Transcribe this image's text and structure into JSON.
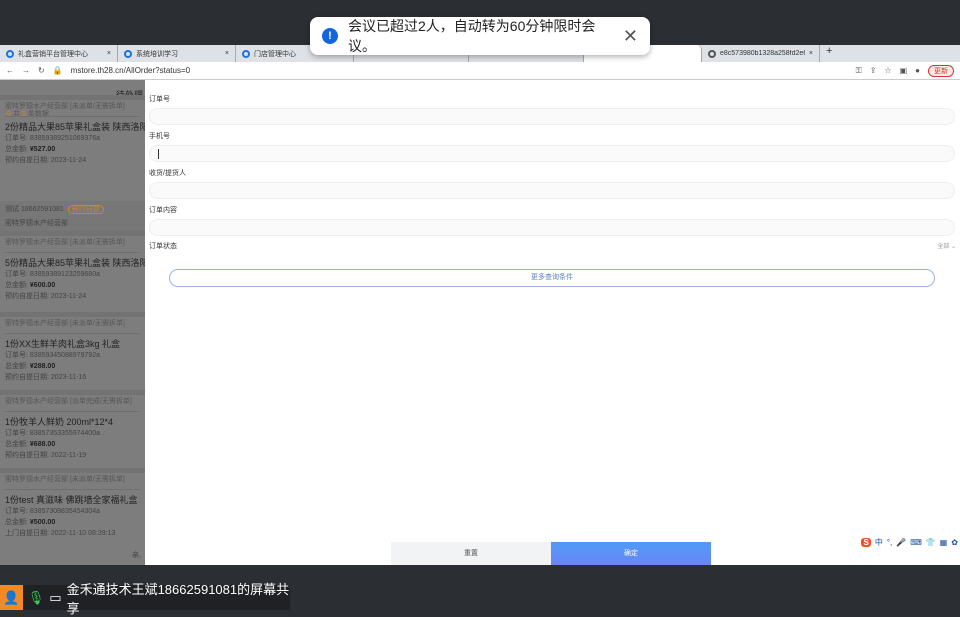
{
  "notification": {
    "message": "会议已超过2人，自动转为60分钟限时会议。",
    "close": "✕"
  },
  "browser": {
    "tabs": [
      {
        "title": "礼盒营销平台管理中心"
      },
      {
        "title": "系统培训学习"
      },
      {
        "title": "门店管理中心"
      },
      {
        "title": "e8c573980b1328a258fd2e6f..."
      }
    ],
    "new_tab": "+",
    "url": "mstore.th28.cn/AllOrder?status=0",
    "update_label": "更新"
  },
  "sidebar": {
    "header": "待处理",
    "count_prefix": "共",
    "count": "5",
    "count_suffix": "条数据",
    "orders": [
      {
        "shop": "密特罗德水产经营部 [未派单/无需拆单]",
        "title": "2份精品大果85苹果礼盒装 陕西洛阳16",
        "order_label": "订单号:",
        "order_no": "83859389251069376a",
        "amount_label": "总金额:",
        "amount": "¥527.00",
        "date_label": "预约自提日期:",
        "date": "2023-11-24",
        "contact": "测试",
        "phone": "18662591081",
        "badge": "预约自提",
        "store": "密特罗德水产经营部"
      },
      {
        "shop": "密特罗德水产经营部 [未派单/无需拆单]",
        "title": "5份精品大果85苹果礼盒装 陕西洛阳16",
        "order_label": "订单号:",
        "order_no": "83859389123259680a",
        "amount_label": "总金额:",
        "amount": "¥600.00",
        "date_label": "预约自提日期:",
        "date": "2023-11-24"
      },
      {
        "shop": "密特罗德水产经营部 [未派单/无需拆单]",
        "title": "1份XX生鲜羊肉礼盒3kg 礼盒",
        "order_label": "订单号:",
        "order_no": "83859345088979792a",
        "amount_label": "总金额:",
        "amount": "¥288.00",
        "date_label": "预约自提日期:",
        "date": "2023-11-16"
      },
      {
        "shop": "密特罗德水产经营部 [派单完成/无需拆单]",
        "title": "1份牧羊人鲜奶 200ml*12*4",
        "order_label": "订单号:",
        "order_no": "83857353355974400a",
        "amount_label": "总金额:",
        "amount": "¥688.00",
        "date_label": "预约自提日期:",
        "date": "2022-11-19"
      },
      {
        "shop": "密特罗德水产经营部 [未派单/无需拆单]",
        "title": "1份test 真滋味 佛跳墙全家福礼盒",
        "order_label": "订单号:",
        "order_no": "83857308835454304a",
        "amount_label": "总金额:",
        "amount": "¥500.00",
        "date_label": "上门自提日期:",
        "date": "2022-11-10 08:39:13"
      }
    ],
    "footer": "亲,"
  },
  "filter": {
    "fields": [
      {
        "label": "订单号",
        "value": ""
      },
      {
        "label": "手机号",
        "value": ""
      },
      {
        "label": "收货/提货人",
        "value": ""
      },
      {
        "label": "订单内容",
        "value": ""
      }
    ],
    "status_label": "订单状态",
    "status_value": "全部",
    "more": "更多查询条件",
    "reset": "重置",
    "confirm": "确定"
  },
  "ime": {
    "logo": "S",
    "items": [
      "中",
      "°,",
      "🎤",
      "⌨",
      "👕",
      "▦",
      "✿"
    ]
  },
  "screen_share": {
    "label": "金禾通技术王斌18662591081的屏幕共享"
  }
}
